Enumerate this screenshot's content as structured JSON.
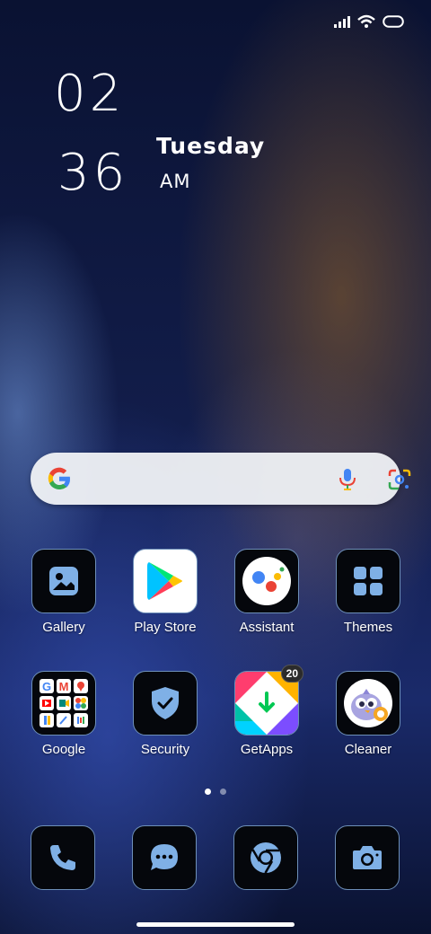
{
  "clock": {
    "hour": "02",
    "minute": "36",
    "day": "Tuesday",
    "ampm": "AM"
  },
  "status": {
    "icons": [
      "signal-icon",
      "wifi-icon",
      "battery-icon"
    ]
  },
  "search": {
    "icons": [
      "google-g-icon",
      "mic-icon",
      "lens-icon"
    ]
  },
  "apps_row1": [
    {
      "label": "Gallery",
      "icon": "gallery-icon"
    },
    {
      "label": "Play Store",
      "icon": "play-store-icon"
    },
    {
      "label": "Assistant",
      "icon": "assistant-icon"
    },
    {
      "label": "Themes",
      "icon": "themes-icon"
    }
  ],
  "apps_row2": [
    {
      "label": "Google",
      "icon": "google-folder-icon"
    },
    {
      "label": "Security",
      "icon": "security-shield-icon"
    },
    {
      "label": "GetApps",
      "icon": "getapps-icon",
      "badge": "20"
    },
    {
      "label": "Cleaner",
      "icon": "cleaner-icon"
    }
  ],
  "dock": [
    {
      "icon": "phone-icon"
    },
    {
      "icon": "messages-icon"
    },
    {
      "icon": "chrome-icon"
    },
    {
      "icon": "camera-icon"
    }
  ],
  "pages": {
    "count": 2,
    "active": 1
  },
  "colors": {
    "icon_accent": "#7fb0e6",
    "icon_border": "#6d8fb8"
  }
}
